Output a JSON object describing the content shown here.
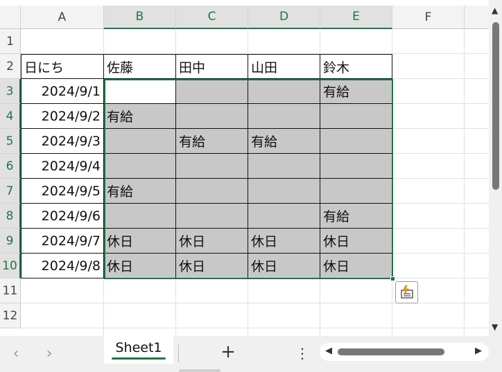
{
  "columns": [
    "A",
    "B",
    "C",
    "D",
    "E",
    "F"
  ],
  "rows": [
    "1",
    "2",
    "3",
    "4",
    "5",
    "6",
    "7",
    "8",
    "9",
    "10",
    "11",
    "12"
  ],
  "table": {
    "header": [
      "日にち",
      "佐藤",
      "田中",
      "山田",
      "鈴木"
    ],
    "data": [
      [
        "2024/9/1",
        "",
        "",
        "",
        "有給"
      ],
      [
        "2024/9/2",
        "有給",
        "",
        "",
        ""
      ],
      [
        "2024/9/3",
        "",
        "有給",
        "有給",
        ""
      ],
      [
        "2024/9/4",
        "",
        "",
        "",
        ""
      ],
      [
        "2024/9/5",
        "有給",
        "",
        "",
        ""
      ],
      [
        "2024/9/6",
        "",
        "",
        "",
        "有給"
      ],
      [
        "2024/9/7",
        "休日",
        "休日",
        "休日",
        "休日"
      ],
      [
        "2024/9/8",
        "休日",
        "休日",
        "休日",
        "休日"
      ]
    ]
  },
  "sheet": {
    "tab_label": "Sheet1",
    "add_label": "+",
    "more_label": "⋮"
  },
  "colors": {
    "accent": "#217346",
    "fill_gray": "#c8c8c8"
  },
  "icons": {
    "quick_analysis": "quick-analysis-icon"
  }
}
